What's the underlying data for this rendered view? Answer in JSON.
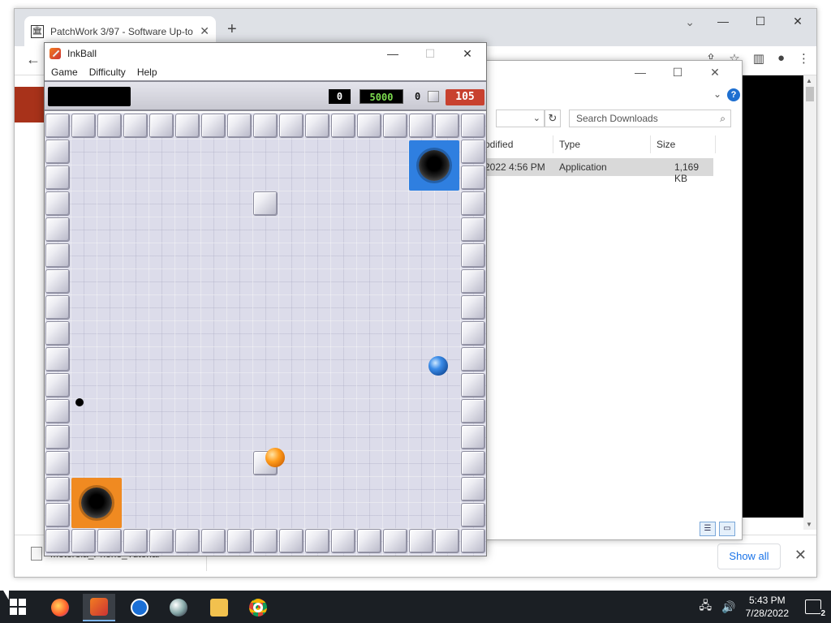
{
  "browser": {
    "tab_title": "PatchWork 3/97 - Software Up-to",
    "tab_close": "✕",
    "new_tab": "+",
    "window_controls": [
      "—",
      "☐",
      "✕"
    ],
    "download_bar": {
      "file_name": "Motorola_Phone_Tutorial",
      "show_all": "Show all",
      "close": "✕"
    }
  },
  "explorer": {
    "search_placeholder": "Search Downloads",
    "columns": {
      "modified": "odified",
      "type": "Type",
      "size": "Size"
    },
    "row": {
      "modified": "2022 4:56 PM",
      "type": "Application",
      "size": "1,169 KB"
    },
    "help": "?"
  },
  "inkball": {
    "title": "InkBall",
    "menu": [
      "Game",
      "Difficulty",
      "Help"
    ],
    "hud": {
      "score": "0",
      "bonus": "5000",
      "grey_count": "0",
      "timer": "105"
    },
    "board": {
      "cols": 17,
      "rows": 17,
      "colors": {
        "blue": "#2f7fe0",
        "orange": "#f08a21",
        "floor": "#dcdcea"
      }
    }
  },
  "taskbar": {
    "apps": [
      "firefox-icon",
      "inkball-icon",
      "teamviewer-icon",
      "marble-icon",
      "file-explorer-icon",
      "chrome-icon"
    ],
    "time": "5:43 PM",
    "date": "7/28/2022",
    "notifications": "2"
  }
}
